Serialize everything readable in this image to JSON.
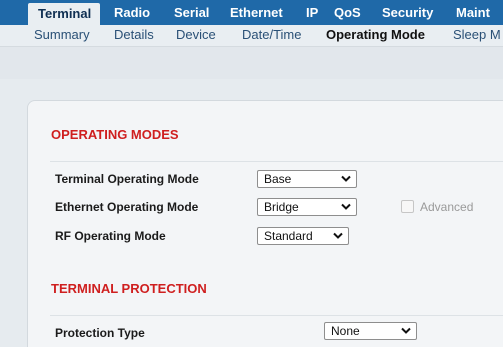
{
  "top_tabs": [
    "Terminal",
    "Radio",
    "Serial",
    "Ethernet",
    "IP",
    "QoS",
    "Security",
    "Maint"
  ],
  "sub_tabs": [
    "Summary",
    "Details",
    "Device",
    "Date/Time",
    "Operating Mode",
    "Sleep M"
  ],
  "operating_modes": {
    "title": "OPERATING MODES",
    "terminal_label": "Terminal Operating Mode",
    "terminal_value": "Base",
    "ethernet_label": "Ethernet Operating Mode",
    "ethernet_value": "Bridge",
    "advanced_label": "Advanced",
    "rf_label": "RF Operating Mode",
    "rf_value": "Standard"
  },
  "terminal_protection": {
    "title": "TERMINAL PROTECTION",
    "protection_label": "Protection Type",
    "protection_value": "None"
  },
  "colors": {
    "nav_bg": "#1f69a8",
    "section_title": "#cf1f1f",
    "subnav_active": "#111111"
  }
}
